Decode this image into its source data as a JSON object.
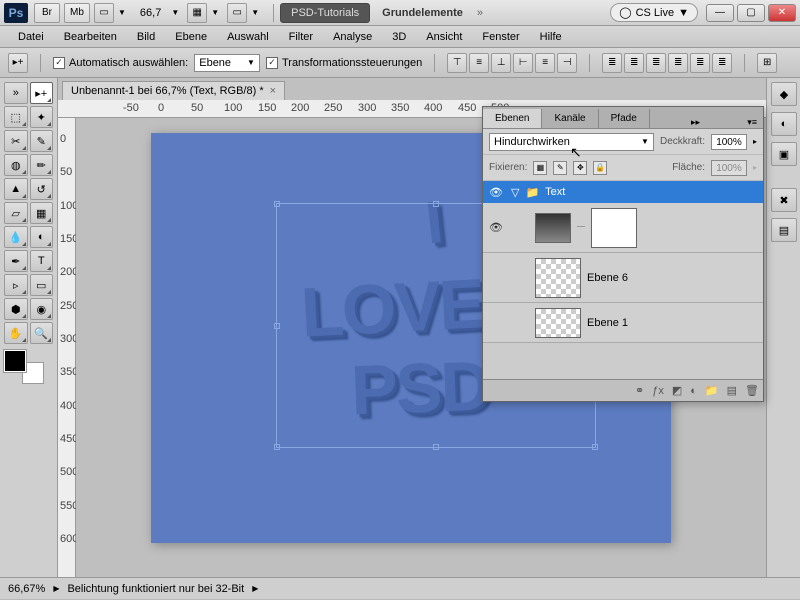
{
  "app": {
    "id": "Ps"
  },
  "titlebar": {
    "buttons": [
      "Br",
      "Mb"
    ],
    "zoom": "66,7",
    "workspace_pill": "PSD-Tutorials",
    "secondary": "Grundelemente",
    "cslive": "CS Live"
  },
  "menubar": [
    "Datei",
    "Bearbeiten",
    "Bild",
    "Ebene",
    "Auswahl",
    "Filter",
    "Analyse",
    "3D",
    "Ansicht",
    "Fenster",
    "Hilfe"
  ],
  "options": {
    "auto_select_label": "Automatisch auswählen:",
    "auto_select_value": "Ebene",
    "transform_label": "Transformationssteuerungen"
  },
  "document": {
    "tab_title": "Unbenannt-1 bei 66,7% (Text, RGB/8) *",
    "ruler_marks": [
      "-50",
      "0",
      "50",
      "100",
      "150",
      "200",
      "250",
      "300",
      "350",
      "400",
      "450",
      "500"
    ],
    "ruler_v": [
      "0",
      "50",
      "100",
      "150",
      "200",
      "250",
      "300",
      "350",
      "400",
      "450",
      "500",
      "550",
      "600"
    ],
    "text_lines": [
      "I",
      "LOVE",
      "PSD"
    ]
  },
  "status": {
    "zoom": "66,67%",
    "info": "Belichtung funktioniert nur bei 32-Bit"
  },
  "layers_panel": {
    "tabs": [
      "Ebenen",
      "Kanäle",
      "Pfade"
    ],
    "blend_mode": "Hindurchwirken",
    "opacity_label": "Deckkraft:",
    "opacity_value": "100%",
    "lock_label": "Fixieren:",
    "fill_label": "Fläche:",
    "fill_value": "100%",
    "group_name": "Text",
    "layers": [
      {
        "name": "",
        "thumbs": 3
      },
      {
        "name": "Ebene 6"
      },
      {
        "name": "Ebene 1"
      }
    ]
  },
  "swatches": {
    "fg": "#000000",
    "bg": "#ffffff"
  },
  "canvas_color": "#5c7bc0"
}
